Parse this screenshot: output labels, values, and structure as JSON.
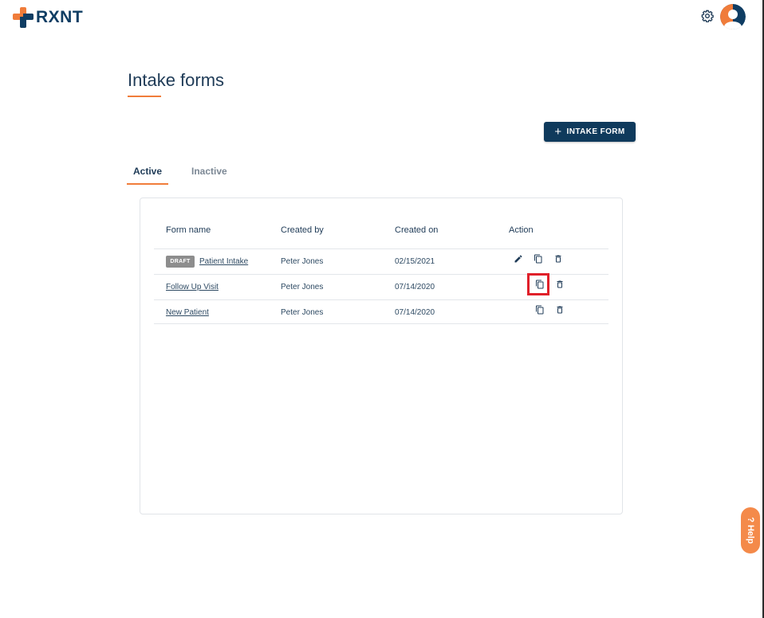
{
  "header": {
    "logo_text": "RXNT",
    "icons": {
      "settings": "gear-icon",
      "profile": "avatar-icon"
    }
  },
  "page": {
    "title": "Intake forms",
    "add_button_label": "INTAKE FORM",
    "add_button_icon": "+"
  },
  "tabs": [
    {
      "label": "Active",
      "selected": true
    },
    {
      "label": "Inactive",
      "selected": false
    }
  ],
  "table": {
    "columns": [
      "Form name",
      "Created by",
      "Created on",
      "Action"
    ],
    "rows": [
      {
        "badge": "DRAFT",
        "name": "Patient Intake",
        "created_by": "Peter Jones",
        "created_on": "02/15/2021",
        "actions": [
          "edit-icon",
          "copy-icon",
          "delete-icon"
        ]
      },
      {
        "badge": "",
        "name": "Follow Up Visit",
        "created_by": "Peter Jones",
        "created_on": "07/14/2020",
        "actions": [
          "copy-icon",
          "delete-icon"
        ]
      },
      {
        "badge": "",
        "name": "New Patient",
        "created_by": "Peter Jones",
        "created_on": "07/14/2020",
        "actions": [
          "copy-icon",
          "delete-icon"
        ]
      }
    ]
  },
  "help": {
    "label": "? Help"
  },
  "colors": {
    "brand_navy": "#0f3d63",
    "brand_orange": "#f07c3a",
    "highlight": "#e0202a",
    "draft_badge": "#8d8d8d"
  }
}
